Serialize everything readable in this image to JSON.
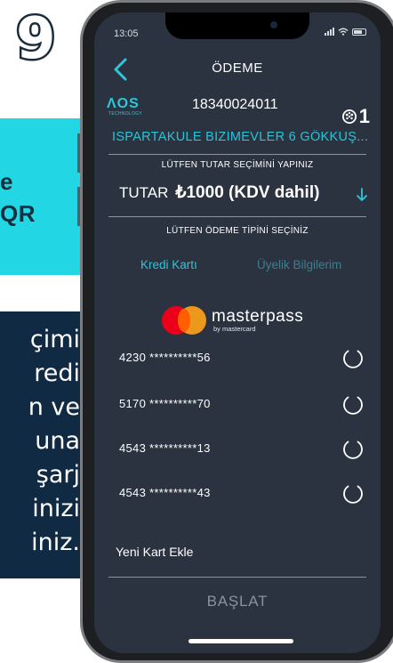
{
  "step": {
    "number": "9"
  },
  "left_panels": {
    "cyan_lines": [
      "e",
      "QR"
    ],
    "navy_lines": [
      "çimi",
      "redi",
      "n ve",
      "una",
      "şarj",
      "inizi",
      "iniz."
    ]
  },
  "status_bar": {
    "time": "13:05"
  },
  "header": {
    "title": "ÖDEME",
    "back_icon": "chevron-left-icon"
  },
  "station": {
    "logo_text": "ΛOS",
    "logo_subtext": "TECHNOLOGY",
    "id": "18340024011",
    "connector_number": "1",
    "connector_icon": "connector-icon",
    "name": "ISPARTAKULE BİZİMEVLER 6 GÖKKUŞ..."
  },
  "amount": {
    "section_label": "LÜTFEN TUTAR SEÇİMİNİ YAPINIZ",
    "label": "TUTAR",
    "value": "₺1000 (KDV dahil)",
    "arrow_icon": "arrow-down-icon"
  },
  "payment": {
    "section_label": "LÜTFEN ÖDEME TİPİNİ SEÇİNİZ",
    "tabs": [
      {
        "label": "Kredi Kartı",
        "active": true
      },
      {
        "label": "Üyelik Bilgilerim",
        "active": false
      }
    ]
  },
  "masterpass": {
    "brand": "masterpass",
    "sub": "by mastercard"
  },
  "cards": [
    {
      "number": "4230 **********56"
    },
    {
      "number": "5170 **********70"
    },
    {
      "number": "4543 **********13"
    },
    {
      "number": "4543 **********43"
    }
  ],
  "add_card_label": "Yeni Kart Ekle",
  "start_button_label": "BAŞLAT",
  "colors": {
    "accent": "#29c3d8",
    "screen_bg": "#2b3340",
    "cyan_panel": "#22d6e4",
    "navy_panel": "#0f2a42",
    "mastercard_red": "#eb001b",
    "mastercard_orange": "#f79e1b"
  }
}
